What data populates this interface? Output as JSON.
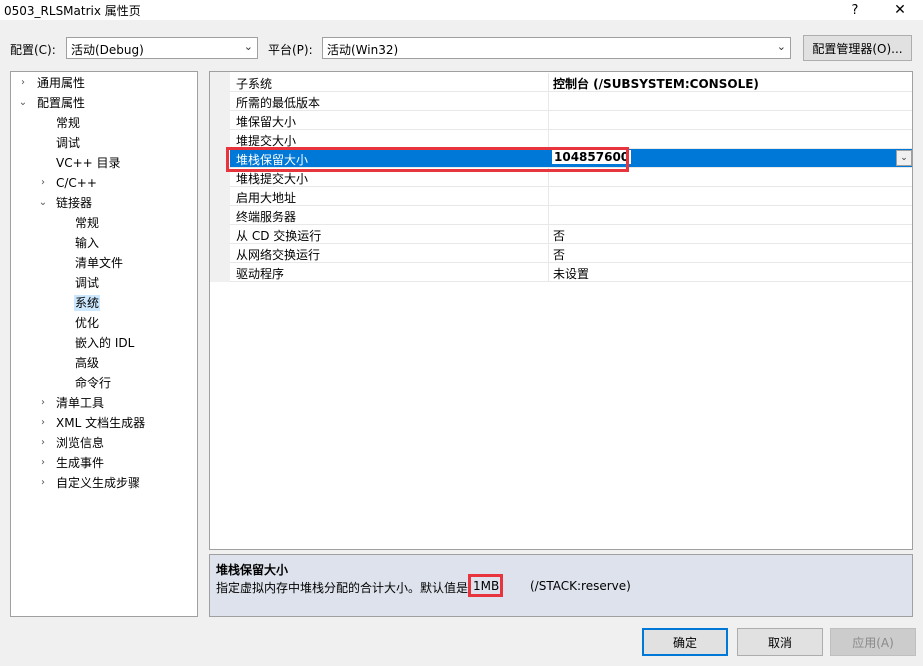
{
  "window": {
    "title": "0503_RLSMatrix 属性页",
    "help_glyph": "?",
    "close_glyph": "✕"
  },
  "toolbar": {
    "config_label": "配置(C):",
    "config_value": "活动(Debug)",
    "platform_label": "平台(P):",
    "platform_value": "活动(Win32)",
    "config_manager_button": "配置管理器(O)..."
  },
  "tree": {
    "items": [
      {
        "label": "通用属性",
        "arrow": "›"
      },
      {
        "label": "配置属性",
        "arrow": "⌄"
      },
      {
        "label": "常规",
        "arrow": ""
      },
      {
        "label": "调试",
        "arrow": ""
      },
      {
        "label": "VC++ 目录",
        "arrow": ""
      },
      {
        "label": "C/C++",
        "arrow": "›"
      },
      {
        "label": "链接器",
        "arrow": "⌄"
      },
      {
        "label": "常规",
        "arrow": ""
      },
      {
        "label": "输入",
        "arrow": ""
      },
      {
        "label": "清单文件",
        "arrow": ""
      },
      {
        "label": "调试",
        "arrow": ""
      },
      {
        "label": "系统",
        "arrow": ""
      },
      {
        "label": "优化",
        "arrow": ""
      },
      {
        "label": "嵌入的 IDL",
        "arrow": ""
      },
      {
        "label": "高级",
        "arrow": ""
      },
      {
        "label": "命令行",
        "arrow": ""
      },
      {
        "label": "清单工具",
        "arrow": "›"
      },
      {
        "label": "XML 文档生成器",
        "arrow": "›"
      },
      {
        "label": "浏览信息",
        "arrow": "›"
      },
      {
        "label": "生成事件",
        "arrow": "›"
      },
      {
        "label": "自定义生成步骤",
        "arrow": "›"
      }
    ]
  },
  "grid": {
    "rows": [
      {
        "name": "子系统",
        "value": "控制台 (/SUBSYSTEM:CONSOLE)"
      },
      {
        "name": "所需的最低版本",
        "value": ""
      },
      {
        "name": "堆保留大小",
        "value": ""
      },
      {
        "name": "堆提交大小",
        "value": ""
      },
      {
        "name": "堆栈保留大小",
        "value": "104857600"
      },
      {
        "name": "堆栈提交大小",
        "value": ""
      },
      {
        "name": "启用大地址",
        "value": ""
      },
      {
        "name": "终端服务器",
        "value": ""
      },
      {
        "name": "从 CD 交换运行",
        "value": "否"
      },
      {
        "name": "从网络交换运行",
        "value": "否"
      },
      {
        "name": "驱动程序",
        "value": "未设置"
      }
    ],
    "dropdown_glyph": "⌄"
  },
  "description": {
    "title": "堆栈保留大小",
    "text": "指定虚拟内存中堆栈分配的合计大小。默认值是",
    "default_value": "1MB",
    "switch": "(/STACK:reserve)"
  },
  "buttons": {
    "ok": "确定",
    "cancel": "取消",
    "apply": "应用(A)"
  },
  "colors": {
    "selection": "#0078d7",
    "highlight_box": "#e8343c",
    "tree_selected": "#cce8ff"
  }
}
